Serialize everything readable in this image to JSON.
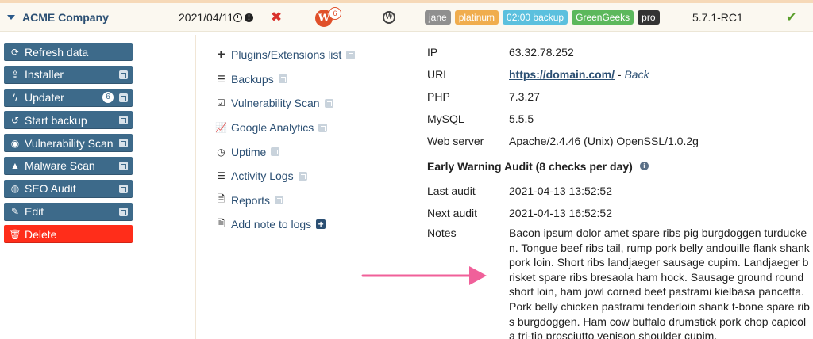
{
  "header": {
    "company": "ACME Company",
    "date": "2021/04/11",
    "wordfence_count": "6",
    "wordfence_letter": "W",
    "wordpress_letter": "W",
    "tags": [
      {
        "label": "jane",
        "color": "#8f8f8f"
      },
      {
        "label": "platinum",
        "color": "#f0ad4e"
      },
      {
        "label": "02:00 backup",
        "color": "#5bc0de"
      },
      {
        "label": "GreenGeeks",
        "color": "#5cb85c"
      },
      {
        "label": "pro",
        "color": "#333333"
      }
    ],
    "version": "5.7.1-RC1",
    "x_glyph": "✖",
    "check_glyph": "✔"
  },
  "actions": {
    "refresh": "Refresh data",
    "installer": "Installer",
    "updater": "Updater",
    "updater_count": "6",
    "start_backup": "Start backup",
    "vulnerability_scan": "Vulnerability Scan",
    "malware_scan": "Malware Scan",
    "seo_audit": "SEO Audit",
    "edit": "Edit",
    "delete": "Delete"
  },
  "links": {
    "plugins": "Plugins/Extensions list",
    "backups": "Backups",
    "vulnerability": "Vulnerability Scan",
    "analytics": "Google Analytics",
    "uptime": "Uptime",
    "activity": "Activity Logs",
    "reports": "Reports",
    "add_note": "Add note to logs"
  },
  "info": {
    "ip_label": "IP",
    "ip": "63.32.78.252",
    "url_label": "URL",
    "url": "https://domain.com/",
    "url_sep": " - ",
    "back": "Back",
    "php_label": "PHP",
    "php": "7.3.27",
    "mysql_label": "MySQL",
    "mysql": "5.5.5",
    "webserver_label": "Web server",
    "webserver": "Apache/2.4.46 (Unix) OpenSSL/1.0.2g",
    "audit_title": "Early Warning Audit (8 checks per day)",
    "last_audit_label": "Last audit",
    "last_audit": "2021-04-13 13:52:52",
    "next_audit_label": "Next audit",
    "next_audit": "2021-04-13 16:52:52",
    "notes_label": "Notes",
    "notes": "Bacon ipsum dolor amet spare ribs pig burgdoggen turducken. Tongue beef ribs tail, rump pork belly andouille flank shank pork loin. Short ribs landjaeger sausage cupim. Landjaeger brisket spare ribs bresaola ham hock. Sausage ground round short loin, ham jowl corned beef pastrami kielbasa pancetta. Pork belly chicken pastrami tenderloin shank t-bone spare ribs burgdoggen. Ham cow buffalo drumstick pork chop capicola tri-tip prosciutto venison shoulder cupim."
  },
  "colors": {
    "button": "#3d6a8a",
    "danger": "#ff2d1a",
    "link": "#2b4f73",
    "arrow": "#f0609a"
  }
}
